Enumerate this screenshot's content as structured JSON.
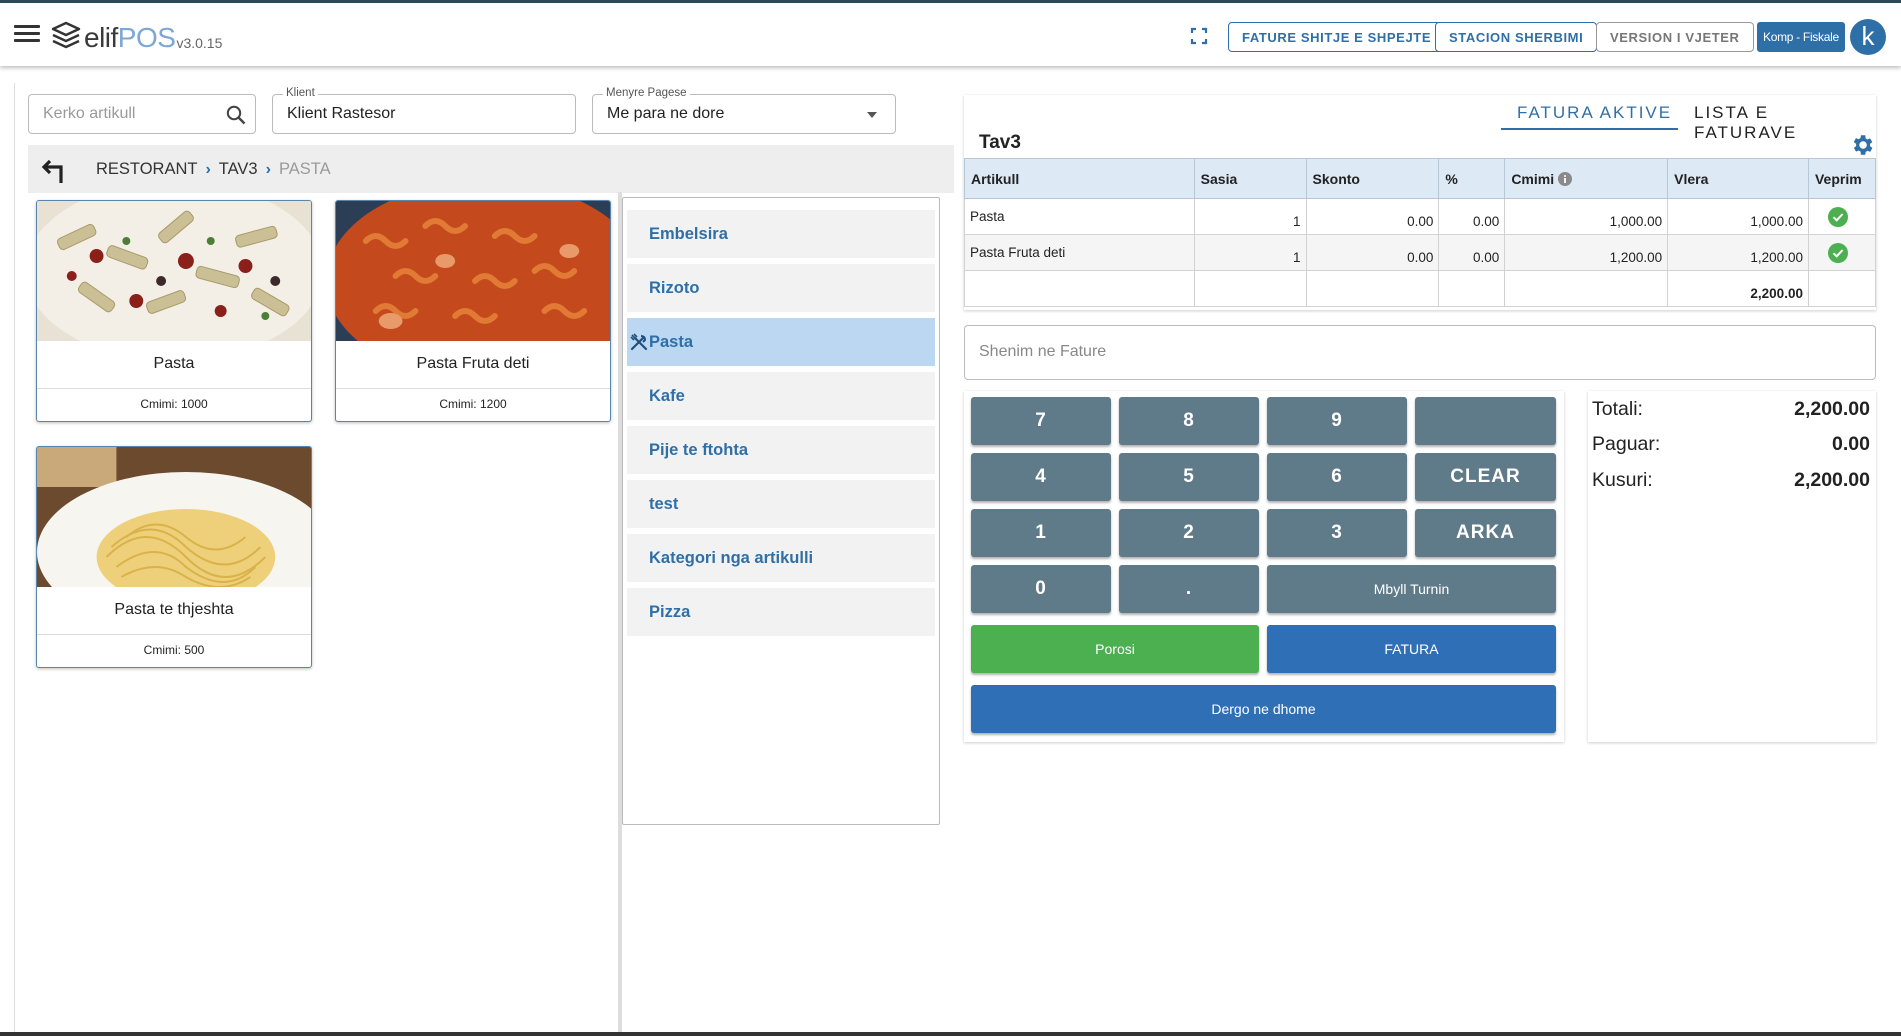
{
  "header": {
    "logo_text_1": "elif",
    "logo_text_2": "POS",
    "version": "v3.0.15",
    "buttons": [
      "FATURE SHITJE E SHPEJTE",
      "STACION SHERBIMI",
      "VERSION I VJETER"
    ],
    "company": "Komp - Fiskale",
    "avatar_letter": "k"
  },
  "filters": {
    "search_placeholder": "Kerko artikull",
    "client_label": "Klient",
    "client_value": "Klient Rastesor",
    "payment_label": "Menyre Pagese",
    "payment_value": "Me para ne dore"
  },
  "breadcrumb": [
    "RESTORANT",
    "TAV3",
    "PASTA"
  ],
  "products": [
    {
      "name": "Pasta",
      "price": "Cmimi: 1000",
      "image": "penne-pasta-dish"
    },
    {
      "name": "Pasta Fruta deti",
      "price": "Cmimi: 1200",
      "image": "fusilli-seafood-dish"
    },
    {
      "name": "Pasta te thjeshta",
      "price": "Cmimi: 500",
      "image": "spaghetti-dish"
    }
  ],
  "categories": [
    "Embelsira",
    "Rizoto",
    "Pasta",
    "Kafe",
    "Pije te ftohta",
    "test",
    "Kategori nga artikulli",
    "Pizza"
  ],
  "selected_category": "Pasta",
  "invoice": {
    "tabs": [
      "FATURA AKTIVE",
      "LISTA E FATURAVE"
    ],
    "table_name": "Tav3",
    "columns": [
      "Artikull",
      "Sasia",
      "Skonto",
      "%",
      "Cmimi",
      "Vlera",
      "Veprim"
    ],
    "rows": [
      {
        "artikull": "Pasta",
        "sasia": "1",
        "skonto": "0.00",
        "perqind": "0.00",
        "cmimi": "1,000.00",
        "vlera": "1,000.00"
      },
      {
        "artikull": "Pasta Fruta deti",
        "sasia": "1",
        "skonto": "0.00",
        "perqind": "0.00",
        "cmimi": "1,200.00",
        "vlera": "1,200.00"
      }
    ],
    "total": "2,200.00",
    "note_placeholder": "Shenim ne Fature"
  },
  "keypad": {
    "keys": [
      "7",
      "8",
      "9",
      "",
      "4",
      "5",
      "6",
      "CLEAR",
      "1",
      "2",
      "3",
      "ARKA",
      "0",
      ".",
      "Mbyll Turnin"
    ],
    "porosi": "Porosi",
    "fatura": "FATURA",
    "dergo": "Dergo ne dhome"
  },
  "totals": [
    {
      "label": "Totali:",
      "value": "2,200.00"
    },
    {
      "label": "Paguar:",
      "value": "0.00"
    },
    {
      "label": "Kusuri:",
      "value": "2,200.00"
    }
  ],
  "colors": {
    "accent": "#2f6fa8",
    "keypad": "#5f7a89",
    "green": "#4caf50",
    "selected": "#bcd7f1"
  }
}
